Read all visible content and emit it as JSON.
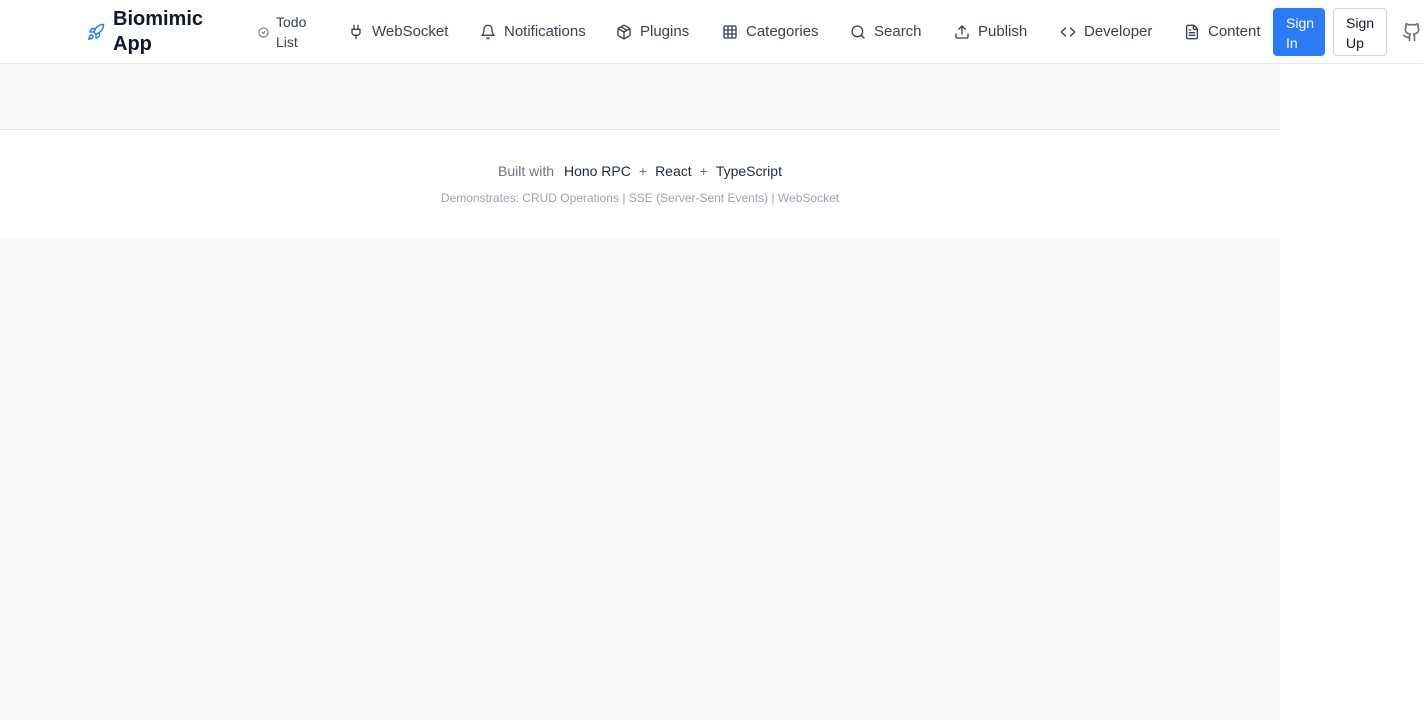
{
  "header": {
    "brand": {
      "title": "Biomimic App",
      "icon": "rocket-icon",
      "icon_color": "#2b7bf7"
    },
    "nav": [
      {
        "id": "todo",
        "label": "Todo List",
        "icon": "check-circle-icon"
      },
      {
        "id": "websocket",
        "label": "WebSocket",
        "icon": "plug-icon"
      },
      {
        "id": "notifications",
        "label": "Notifications",
        "icon": "bell-icon"
      },
      {
        "id": "plugins",
        "label": "Plugins",
        "icon": "package-icon"
      },
      {
        "id": "categories",
        "label": "Categories",
        "icon": "grid-icon"
      },
      {
        "id": "search",
        "label": "Search",
        "icon": "search-icon"
      },
      {
        "id": "publish",
        "label": "Publish",
        "icon": "upload-icon"
      },
      {
        "id": "developer",
        "label": "Developer",
        "icon": "code-icon"
      },
      {
        "id": "content",
        "label": "Content",
        "icon": "file-text-icon"
      }
    ],
    "auth": {
      "sign_in": "Sign In",
      "sign_up": "Sign Up"
    },
    "github_icon": "github-icon",
    "accent": "#2b7bf7"
  },
  "footer": {
    "built_with": "Built with",
    "technologies": [
      "Hono RPC",
      "React",
      "TypeScript"
    ],
    "separator": "+",
    "demonstrates": "Demonstrates: CRUD Operations | SSE (Server-Sent Events) | WebSocket"
  }
}
